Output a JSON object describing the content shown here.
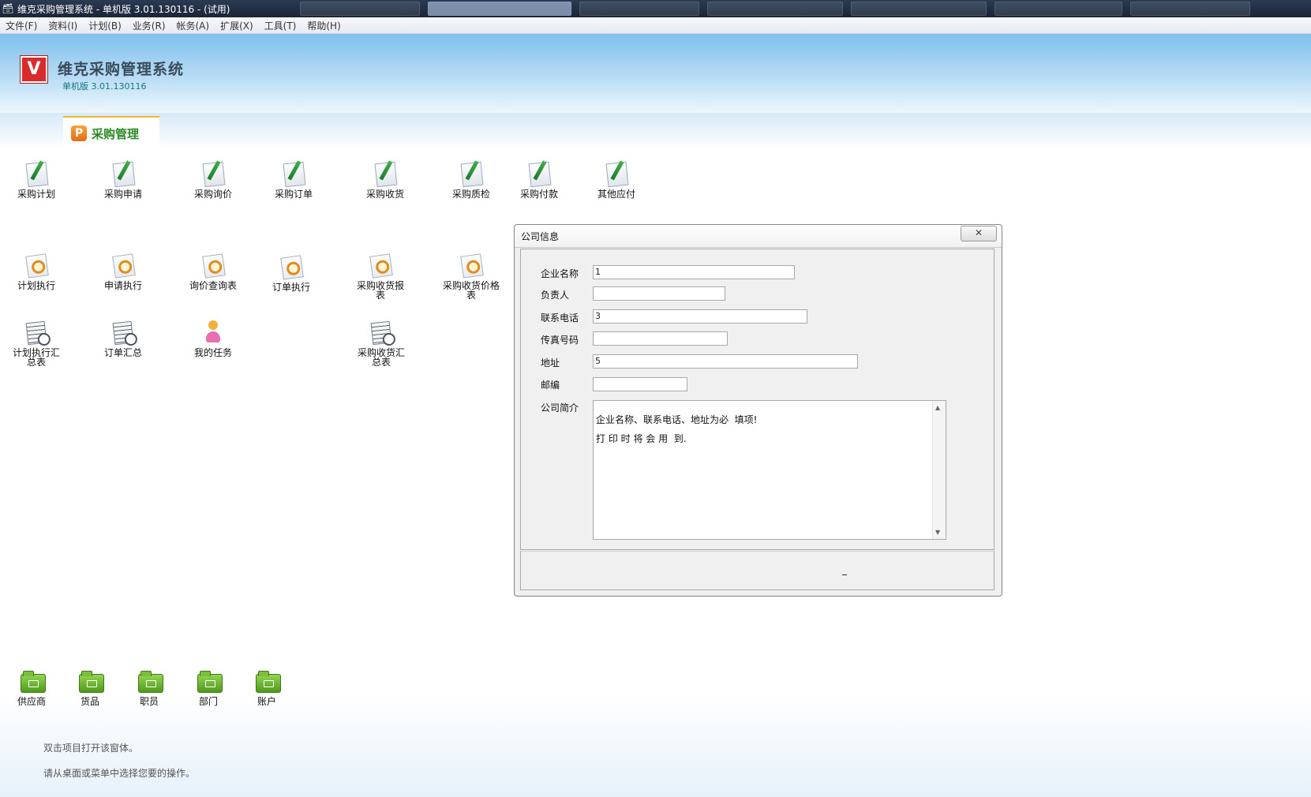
{
  "window": {
    "title": "维克采购管理系统 - 单机版 3.01.130116 - (试用)"
  },
  "menu": [
    "文件(F)",
    "资料(I)",
    "计划(B)",
    "业务(R)",
    "帐务(A)",
    "扩展(X)",
    "工具(T)",
    "帮助(H)"
  ],
  "header": {
    "logo_letter": "V",
    "app_name": "维克采购管理系统",
    "version": "单机版 3.01.130116"
  },
  "tab": {
    "icon_letter": "P",
    "label": "采购管理"
  },
  "row1": [
    "采购计划",
    "采购申请",
    "采购询价",
    "采购订单",
    "采购收货",
    "采购质检",
    "采购付款",
    "其他应付"
  ],
  "row2": [
    "计划执行",
    "申请执行",
    "询价查询表",
    "订单执行",
    "采购收货报表",
    "采购收货价格表"
  ],
  "row3": [
    "计划执行汇总表",
    "订单汇总",
    "我的任务",
    "采购收货汇总表"
  ],
  "bottom_icons": [
    "供应商",
    "货品",
    "职员",
    "部门",
    "账户"
  ],
  "hints": [
    "双击项目打开该窗体。",
    "请从桌面或菜单中选择您要的操作。"
  ],
  "dialog": {
    "title": "公司信息",
    "close_glyph": "✕",
    "fields": {
      "company_name": {
        "label": "企业名称",
        "value": "1"
      },
      "owner": {
        "label": "负责人",
        "value": ""
      },
      "phone": {
        "label": "联系电话",
        "value": "3"
      },
      "fax": {
        "label": "传真号码",
        "value": ""
      },
      "address": {
        "label": "地址",
        "value": "5"
      },
      "zip": {
        "label": "邮编",
        "value": ""
      },
      "intro": {
        "label": "公司简介",
        "value": "企业名称、联系电话、地址为必  填项!\n打 印 时 将 会 用  到."
      }
    },
    "footer_button": "_"
  }
}
